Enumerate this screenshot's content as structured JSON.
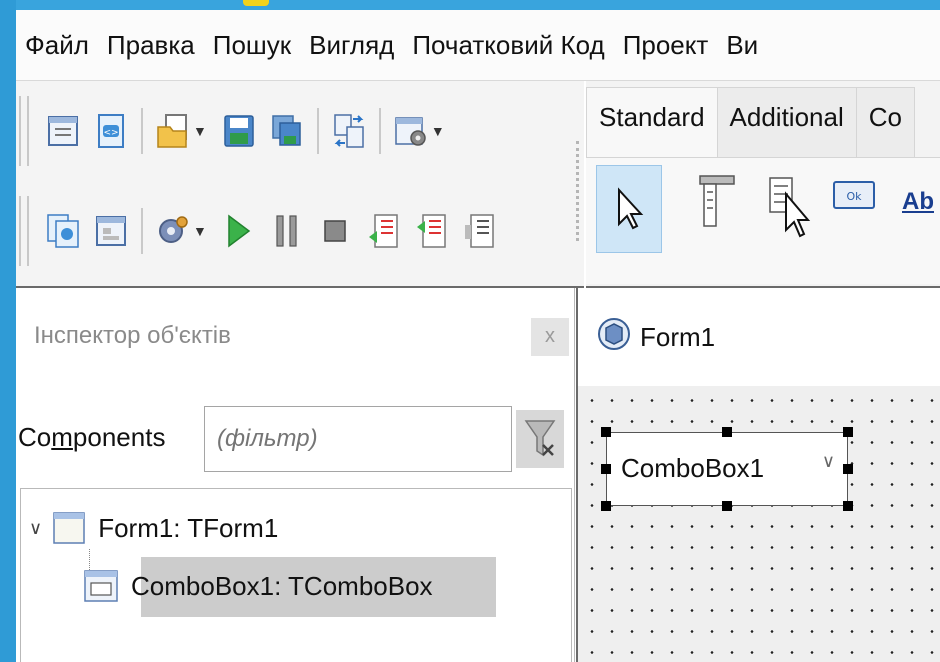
{
  "menu": {
    "items": [
      "Файл",
      "Правка",
      "Пошук",
      "Вигляд",
      "Початковий Код",
      "Проект",
      "Ви"
    ]
  },
  "toolbar": {
    "row1": [
      "view-units-icon",
      "view-forms-icon",
      "new-file-icon",
      "save-icon",
      "save-all-icon",
      "toggle-form-unit-icon",
      "project-options-icon"
    ],
    "row2": [
      "add-to-project-icon",
      "view-form-icon",
      "build-mode-icon",
      "run-icon",
      "pause-icon",
      "stop-icon",
      "step-into-icon",
      "step-over-icon",
      "step-out-icon"
    ]
  },
  "palette": {
    "tabs": [
      "Standard",
      "Additional",
      "Co"
    ],
    "active_tab": "Standard",
    "partial_label": "Ab"
  },
  "inspector": {
    "title": "Інспектор об'єктів",
    "close_label": "x",
    "components_label_pre": "Co",
    "components_label_mnemonic": "m",
    "components_label_post": "ponents",
    "filter_placeholder": "(фільтр)",
    "tree": [
      {
        "label": "Form1: TForm1",
        "expanded": true
      },
      {
        "label": "ComboBox1: TComboBox",
        "selected": true
      }
    ]
  },
  "designer": {
    "form_title": "Form1",
    "combobox_text": "ComboBox1"
  },
  "colors": {
    "frame_blue": "#2f9bd6",
    "accent_yellow": "#f2d21c",
    "selection_grey": "#cccccc",
    "palette_selection": "#cfe6f7"
  }
}
